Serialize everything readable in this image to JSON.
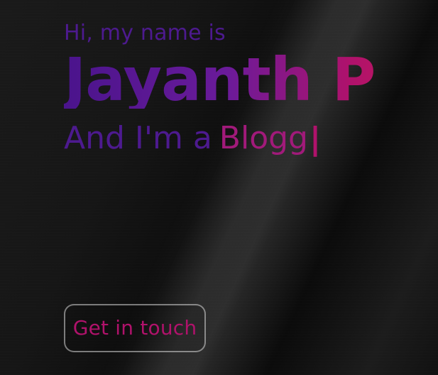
{
  "hero": {
    "greeting": "Hi, my name is",
    "name": "Jayanth P",
    "tagline_prefix": "And I'm a",
    "typed_role": "Blogg",
    "cursor": "|"
  },
  "cta": {
    "label": "Get in touch"
  },
  "colors": {
    "purple": "#4d1a8f",
    "magenta": "#b0126b",
    "gradient_start": "#4a148c",
    "gradient_end": "#c2185b",
    "button_border": "rgba(255,255,255,0.45)",
    "background": "#111111"
  }
}
